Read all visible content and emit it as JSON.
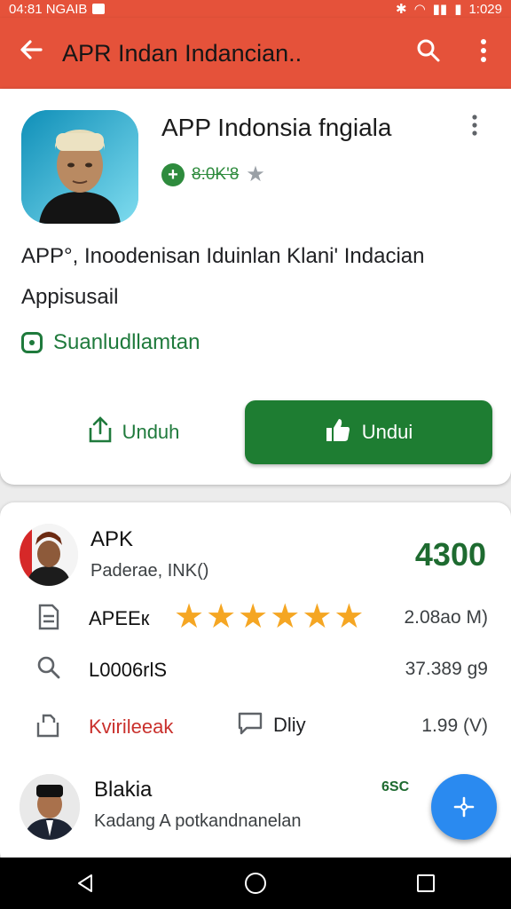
{
  "status_bar": {
    "time": "04:81 NGAIB",
    "clock": "1:029"
  },
  "app_bar": {
    "title": "APR Indan  Indancian.."
  },
  "app_card": {
    "title": "APP Indonsia fngiala",
    "rating_text": "8:0K'8",
    "description_line1": "APP°, Inoodenisan Iduinlan Klani' Indacian",
    "description_line2": "Appisusail",
    "sub_link": "Suanludllamtan",
    "outline_button_label": "Unduh",
    "fill_button_label": "Undui"
  },
  "list": {
    "item1": {
      "title": "APK",
      "subtitle": "Paderae,  INK()",
      "score": "4300"
    },
    "rows": [
      {
        "label": "APEEк",
        "value": "2.08ao M)",
        "stars": 6
      },
      {
        "label": "L0006rlS",
        "value": "37.389 g9"
      },
      {
        "label": "Kvirileeak",
        "mid_label": "Dliy",
        "value": "1.99 (V)"
      }
    ],
    "item2": {
      "title": "Blakia",
      "subtitle": "Kadang A potkandnanelan",
      "badge": "6SC"
    }
  },
  "colors": {
    "accent_header": "#e5523a",
    "primary_green": "#1e7d32",
    "star": "#f5a623",
    "fab": "#2a8af0"
  },
  "icons": [
    "back-arrow-icon",
    "search-icon",
    "more-vert-icon",
    "plus-icon",
    "star-icon",
    "share-icon",
    "like-icon",
    "doc-icon",
    "search-icon",
    "bookmark-icon",
    "chat-icon",
    "fab-icon",
    "nav-back-icon",
    "nav-home-icon",
    "nav-recents-icon"
  ]
}
